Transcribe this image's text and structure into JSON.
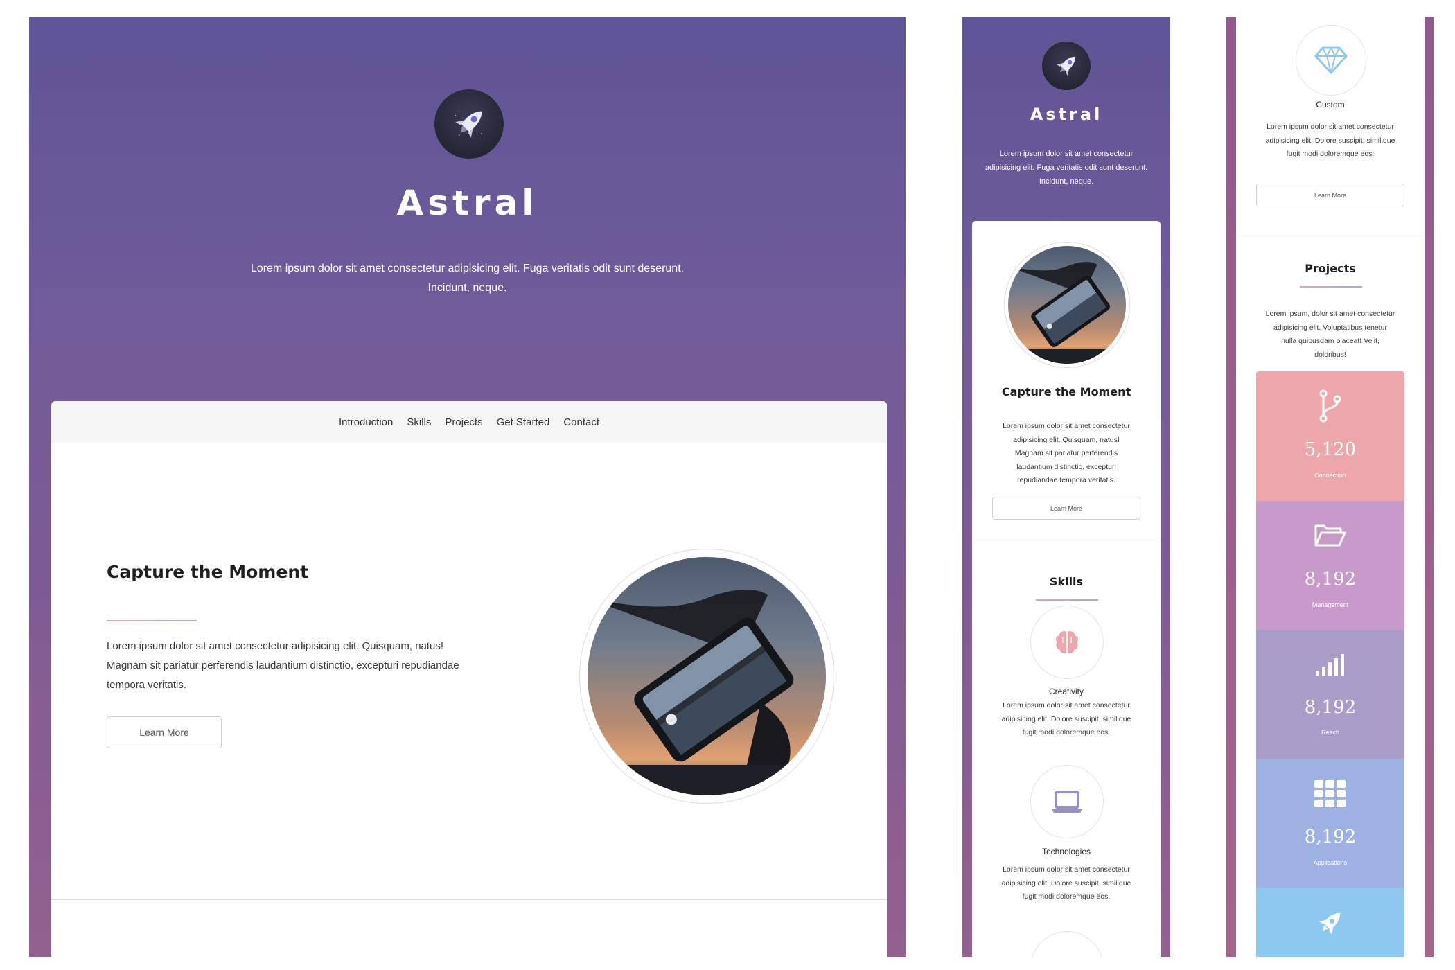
{
  "hero": {
    "brand": "Astral",
    "tagline_1": "Lorem ipsum dolor sit amet consectetur adipisicing elit. Fuga veritatis odit sunt deserunt.",
    "tagline_2": "Incidunt, neque."
  },
  "mobile_hero": {
    "brand": "Astral",
    "tagline_1": "Lorem ipsum dolor sit amet consectetur",
    "tagline_2": "adipisicing elit. Fuga veritatis odit sunt deserunt.",
    "tagline_3": "Incidunt, neque."
  },
  "nav": {
    "items": [
      "Introduction",
      "Skills",
      "Projects",
      "Get Started",
      "Contact"
    ]
  },
  "intro": {
    "title": "Capture the Moment",
    "text_1": "Lorem ipsum dolor sit amet consectetur adipisicing elit. Quisquam, natus!",
    "text_2": "Magnam sit pariatur perferendis laudantium distinctio, excepturi repudiandae",
    "text_3": "tempora veritatis.",
    "button": "Learn More"
  },
  "mobile_intro": {
    "title": "Capture the Moment",
    "lines": [
      "Lorem ipsum dolor sit amet consectetur",
      "adipisicing elit. Quisquam, natus!",
      "Magnam sit pariatur perferendis",
      "laudantium distinctio, excepturi",
      "repudiandae tempora veritatis."
    ],
    "button": "Learn More"
  },
  "skills": {
    "title": "Skills",
    "items": [
      {
        "name": "Creativity",
        "lines": [
          "Lorem ipsum dolor sit amet consectetur",
          "adipisicing elit. Dolore suscipit, similique",
          "fugit modi doloremque eos."
        ]
      },
      {
        "name": "Technologies",
        "lines": [
          "Lorem ipsum dolor sit amet consectetur",
          "adipisicing elit. Dolore suscipit, similique",
          "fugit modi doloremque eos."
        ]
      }
    ]
  },
  "custom": {
    "name": "Custom",
    "lines": [
      "Lorem ipsum dolor sit amet consectetur",
      "adipisicing elit. Dolore suscipit, similique",
      "fugit modi doloremque eos."
    ],
    "button": "Learn More"
  },
  "projects": {
    "title": "Projects",
    "lines": [
      "Lorem ipsum, dolor sit amet consectetur",
      "adipisicing elit. Voluptatibus tenetur",
      "nulla quibusdam placeat! Velit,",
      "doloribus!"
    ],
    "stats": [
      {
        "value": "5,120",
        "label": "Connection",
        "color": "#eea6ad",
        "icon": "code-branch-icon"
      },
      {
        "value": "8,192",
        "label": "Management",
        "color": "#c79ac9",
        "icon": "folder-open-icon"
      },
      {
        "value": "8,192",
        "label": "Reach",
        "color": "#a99cc9",
        "icon": "signal-bars-icon"
      },
      {
        "value": "8,192",
        "label": "Applications",
        "color": "#9db2e2",
        "icon": "grid-icon"
      },
      {
        "value": "",
        "label": "",
        "color": "#8cc8ef",
        "icon": "rocket-icon"
      }
    ]
  },
  "colors": {
    "hero_top": "#5f5597",
    "hero_bottom": "#93618e",
    "underline_start": "#eaa3b1",
    "underline_end": "#9bb0e0"
  }
}
